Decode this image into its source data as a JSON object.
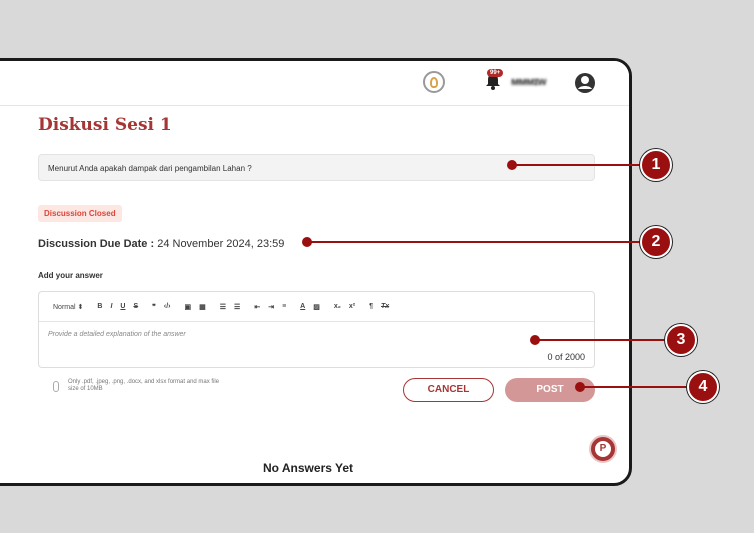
{
  "header": {
    "notification_count": "99+",
    "username": "ᴍᴍᴍɪᴡ"
  },
  "page": {
    "title": "Diskusi Sesi 1",
    "question": "Menurut Anda apakah dampak dari pengambilan Lahan ?",
    "status_badge": "Discussion Closed",
    "due_label": "Discussion Due Date :",
    "due_value": "24 November 2024, 23:59",
    "add_answer_label": "Add your answer"
  },
  "editor": {
    "toolbar": [
      {
        "name": "format-select",
        "label": "Normal ⬍"
      },
      {
        "name": "bold-button",
        "label": "B"
      },
      {
        "name": "italic-button",
        "label": "I"
      },
      {
        "name": "underline-button",
        "label": "U"
      },
      {
        "name": "strike-button",
        "label": "S"
      },
      {
        "name": "quote-button",
        "label": "❞"
      },
      {
        "name": "code-button",
        "label": "‹/›"
      },
      {
        "name": "image-button",
        "label": "▣"
      },
      {
        "name": "video-button",
        "label": "▦"
      },
      {
        "name": "ordered-list-button",
        "label": "☰"
      },
      {
        "name": "bullet-list-button",
        "label": "☰"
      },
      {
        "name": "indent-decrease-button",
        "label": "⇤"
      },
      {
        "name": "indent-increase-button",
        "label": "⇥"
      },
      {
        "name": "align-button",
        "label": "≡"
      },
      {
        "name": "text-color-button",
        "label": "A"
      },
      {
        "name": "highlight-button",
        "label": "▨"
      },
      {
        "name": "subscript-button",
        "label": "x₂"
      },
      {
        "name": "superscript-button",
        "label": "x²"
      },
      {
        "name": "rtl-button",
        "label": "¶"
      },
      {
        "name": "clear-format-button",
        "label": "Tx"
      }
    ],
    "placeholder": "Provide a detailed explanation of the answer",
    "counter": "0  of  2000"
  },
  "attachment_note": "Only .pdf, .jpeg, .png, .docx, and xlsx format and max file size of 10MB",
  "buttons": {
    "cancel": "CANCEL",
    "post": "POST"
  },
  "empty_state": "No Answers Yet",
  "help_fab_letter": "P",
  "callouts": [
    "1",
    "2",
    "3",
    "4"
  ],
  "colors": {
    "brand": "#a63535",
    "callout": "#9a0f0f",
    "post_disabled": "#d49797",
    "closed_badge_bg": "#fde7e3",
    "closed_badge_text": "#d9463b"
  }
}
